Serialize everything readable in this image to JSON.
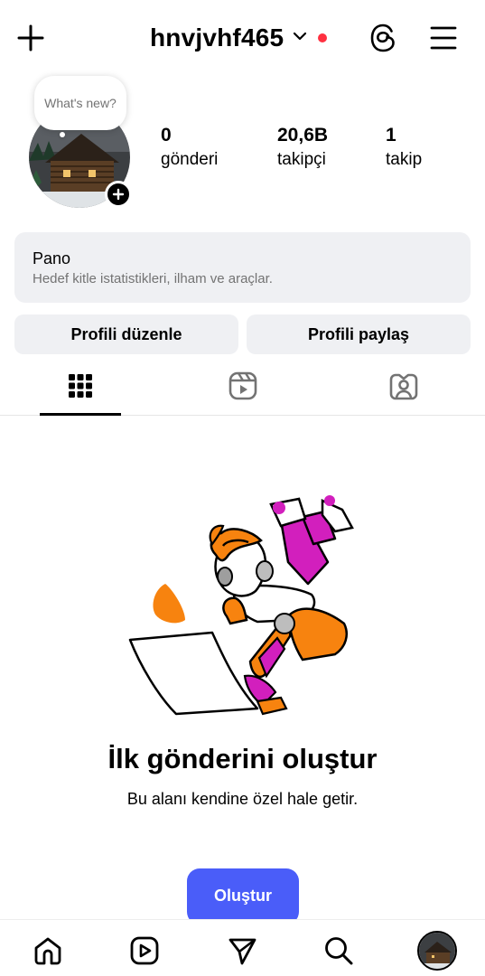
{
  "header": {
    "username": "hnvjvhf465",
    "icons": {
      "create": "plus-icon",
      "account_switch": "chevron-down-icon",
      "threads": "threads-icon",
      "menu": "hamburger-menu-icon"
    },
    "notification_dot_color": "#ff3040"
  },
  "profile": {
    "note_bubble": "What's new?",
    "stats": [
      {
        "value": "0",
        "label": "gönderi"
      },
      {
        "value": "20,6B",
        "label": "takipçi"
      },
      {
        "value": "1",
        "label": "takip"
      }
    ]
  },
  "dashboard": {
    "title": "Pano",
    "subtitle": "Hedef kitle istatistikleri, ilham ve araçlar."
  },
  "actions": {
    "edit_profile": "Profili düzenle",
    "share_profile": "Profili paylaş"
  },
  "tabs": [
    {
      "icon": "grid-icon",
      "selected": true
    },
    {
      "icon": "reels-icon",
      "selected": false
    },
    {
      "icon": "tagged-icon",
      "selected": false
    }
  ],
  "empty_state": {
    "title": "İlk gönderini oluştur",
    "subtitle": "Bu alanı kendine özel hale getir.",
    "button": "Oluştur"
  },
  "bottom_nav": [
    "home-icon",
    "reels-icon",
    "direct-message-icon",
    "search-icon",
    "profile-avatar"
  ],
  "colors": {
    "accent": "#4a5df9",
    "card_background": "#eff0f3",
    "illustration_orange": "#f7830f",
    "illustration_magenta": "#d21fbd"
  }
}
